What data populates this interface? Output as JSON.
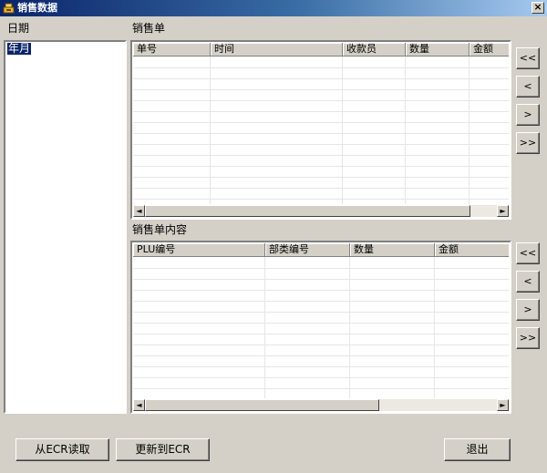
{
  "window": {
    "title": "销售数据",
    "close_glyph": "×"
  },
  "date_panel": {
    "label": "日期",
    "items": [
      "年月"
    ]
  },
  "sales_order": {
    "label": "销售单",
    "columns": [
      "单号",
      "时间",
      "收款员",
      "数量",
      "金额"
    ],
    "scroll_left_glyph": "◄",
    "scroll_right_glyph": "►",
    "nav": {
      "first": "<<",
      "prev": "<",
      "next": ">",
      "last": ">>"
    }
  },
  "order_detail": {
    "label": "销售单内容",
    "columns": [
      "PLU编号",
      "部类编号",
      "数量",
      "金额"
    ],
    "scroll_left_glyph": "◄",
    "scroll_right_glyph": "►",
    "nav": {
      "first": "<<",
      "prev": "<",
      "next": ">",
      "last": ">>"
    }
  },
  "buttons": {
    "read_from_ecr": "从ECR读取",
    "update_to_ecr": "更新到ECR",
    "exit": "退出"
  },
  "icons": {
    "app": "cash-register-icon",
    "close": "close-icon"
  }
}
